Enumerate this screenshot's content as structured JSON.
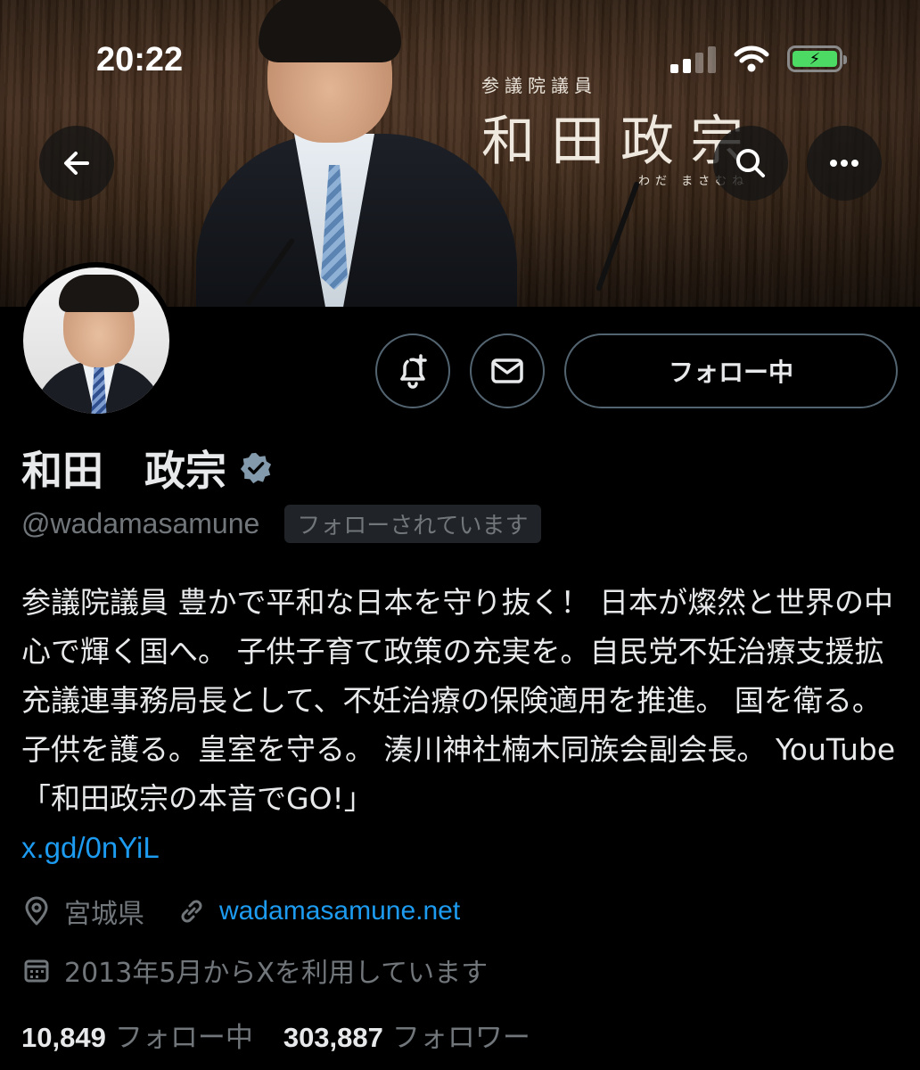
{
  "status_bar": {
    "time": "20:22"
  },
  "banner": {
    "title_small": "参議院議員",
    "title_big": "和田政宗",
    "title_kana": "わだ まさむね"
  },
  "icons": {
    "back": "arrow-left-icon",
    "search": "search-icon",
    "more": "more-horizontal-icon",
    "notify": "bell-plus-icon",
    "message": "envelope-icon",
    "verified": "verified-badge-icon",
    "location": "location-pin-icon",
    "website": "link-icon",
    "joined": "calendar-icon"
  },
  "colors": {
    "accent": "#1d9bf0",
    "muted": "#71767b",
    "badge_gray": "#829aab",
    "battery": "#4cd964"
  },
  "profile": {
    "follow_button_label": "フォロー中",
    "display_name": "和田　政宗",
    "handle": "@wadamasamune",
    "follows_you": "フォローされています",
    "bio_text": "参議院議員 豊かで平和な日本を守り抜く！ 日本が燦然と世界の中心で輝く国へ。 子供子育て政策の充実を。自民党不妊治療支援拡充議連事務局長として、不妊治療の保険適用を推進。 国を衛る。子供を護る。皇室を守る。 湊川神社楠木同族会副会長。 YouTube「和田政宗の本音でGO!」",
    "bio_link": "x.gd/0nYiL",
    "location": "宮城県",
    "website": "wadamasamune.net",
    "joined": "2013年5月からXを利用しています",
    "following_count": "10,849",
    "following_label": "フォロー中",
    "followers_count": "303,887",
    "followers_label": "フォロワー"
  }
}
